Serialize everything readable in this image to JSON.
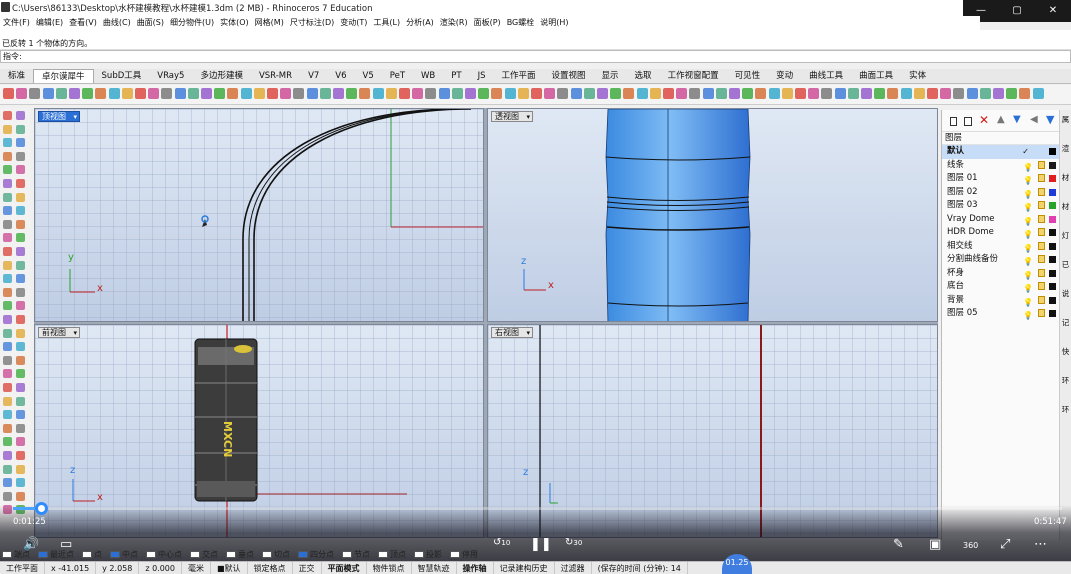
{
  "window": {
    "title": "C:\\Users\\86133\\Desktop\\水杯建模教程\\水杯建模1.3dm (2 MB) - Rhinoceros 7 Education",
    "controls": [
      "—",
      "▢",
      "✕"
    ]
  },
  "menu": [
    "文件(F)",
    "编辑(E)",
    "查看(V)",
    "曲线(C)",
    "曲面(S)",
    "细分物件(U)",
    "实体(O)",
    "网格(M)",
    "尺寸标注(D)",
    "变动(T)",
    "工具(L)",
    "分析(A)",
    "渲染(R)",
    "面板(P)",
    "BG螺栓",
    "说明(H)"
  ],
  "command": {
    "history": [
      "已反转 1 个物体的方向。"
    ],
    "prompt": "指令:"
  },
  "tabs": [
    {
      "label": "标准",
      "active": false
    },
    {
      "label": "卓尔谟犀牛",
      "active": true
    },
    {
      "label": "SubD工具",
      "active": false
    },
    {
      "label": "VRay5",
      "active": false
    },
    {
      "label": "多边形建模",
      "active": false
    },
    {
      "label": "VSR-MR",
      "active": false
    },
    {
      "label": "V7",
      "active": false
    },
    {
      "label": "V6",
      "active": false
    },
    {
      "label": "V5",
      "active": false
    },
    {
      "label": "PeT",
      "active": false
    },
    {
      "label": "WB",
      "active": false
    },
    {
      "label": "PT",
      "active": false
    },
    {
      "label": "JS",
      "active": false
    },
    {
      "label": "工作平面",
      "active": false
    },
    {
      "label": "设置视图",
      "active": false
    },
    {
      "label": "显示",
      "active": false
    },
    {
      "label": "选取",
      "active": false
    },
    {
      "label": "工作视窗配置",
      "active": false
    },
    {
      "label": "可见性",
      "active": false
    },
    {
      "label": "变动",
      "active": false
    },
    {
      "label": "曲线工具",
      "active": false
    },
    {
      "label": "曲面工具",
      "active": false
    },
    {
      "label": "实体",
      "active": false
    }
  ],
  "viewports": {
    "top": {
      "label": "顶视图",
      "active": true
    },
    "perspective": {
      "label": "透视图",
      "active": false
    },
    "front": {
      "label": "前视图",
      "active": false,
      "object_text": "MXCN"
    },
    "right": {
      "label": "右视图",
      "active": false
    }
  },
  "axes": {
    "x": "x",
    "y": "y",
    "z": "z"
  },
  "layers": {
    "header": "图层",
    "items": [
      {
        "name": "默认",
        "color": "#000000",
        "current": true
      },
      {
        "name": "线条",
        "color": "#1a1a1a"
      },
      {
        "name": "图层 01",
        "color": "#e02020"
      },
      {
        "name": "图层 02",
        "color": "#1f3bd6"
      },
      {
        "name": "图层 03",
        "color": "#2aa32a"
      },
      {
        "name": "Vray Dome",
        "color": "#e040b0"
      },
      {
        "name": "HDR Dome",
        "color": "#111111"
      },
      {
        "name": "相交线",
        "color": "#111111"
      },
      {
        "name": "分割曲线备份",
        "color": "#111111"
      },
      {
        "name": "杯身",
        "color": "#111111"
      },
      {
        "name": "底台",
        "color": "#111111"
      },
      {
        "name": "背景",
        "color": "#111111"
      },
      {
        "name": "图层 05",
        "color": "#111111"
      }
    ]
  },
  "side_panel_tabs": [
    "属",
    "渲",
    "材",
    "材",
    "灯",
    "已",
    "说",
    "记",
    "快",
    "环",
    "环"
  ],
  "video": {
    "current": "0:01:25",
    "total": "0:51:47",
    "progress": 0.027,
    "rewind": "10",
    "forward": "30",
    "quality": "360",
    "badge": "01.25"
  },
  "osnap": [
    "端点",
    "最近点",
    "点",
    "中点",
    "中心点",
    "交点",
    "垂点",
    "切点",
    "四分点",
    "节点",
    "顶点",
    "投影",
    "停用"
  ],
  "osnap_checked": [
    false,
    true,
    false,
    true,
    false,
    false,
    false,
    false,
    true,
    false,
    false,
    false,
    false
  ],
  "status": [
    "工作平面",
    "x -41.015",
    "y 2.058",
    "z 0.000",
    "毫米",
    "■默认",
    "锁定格点",
    "正交",
    "平面模式",
    "物件锁点",
    "智慧轨迹",
    "操作轴",
    "记录建构历史",
    "过滤器",
    "(保存的时间 (分钟): 14"
  ]
}
